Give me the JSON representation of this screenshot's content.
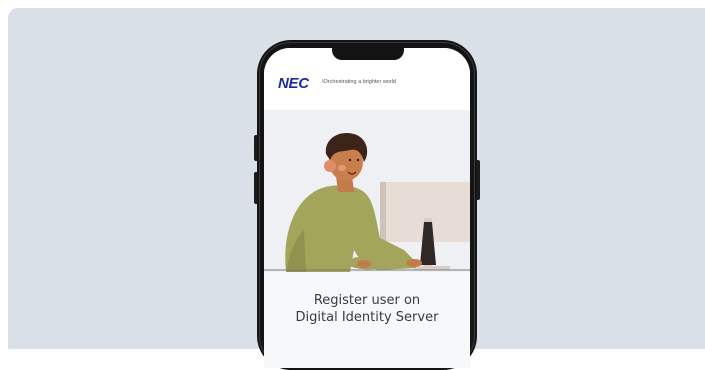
{
  "brand": {
    "logo": "NEC",
    "tagline": "\\Orchestrating a brighter world"
  },
  "screen": {
    "title_line1": "Register user on",
    "title_line2": "Digital Identity Server"
  },
  "colors": {
    "background": "#dae0e8",
    "brand_blue": "#1d2d9c",
    "shirt": "#a3a65a"
  }
}
